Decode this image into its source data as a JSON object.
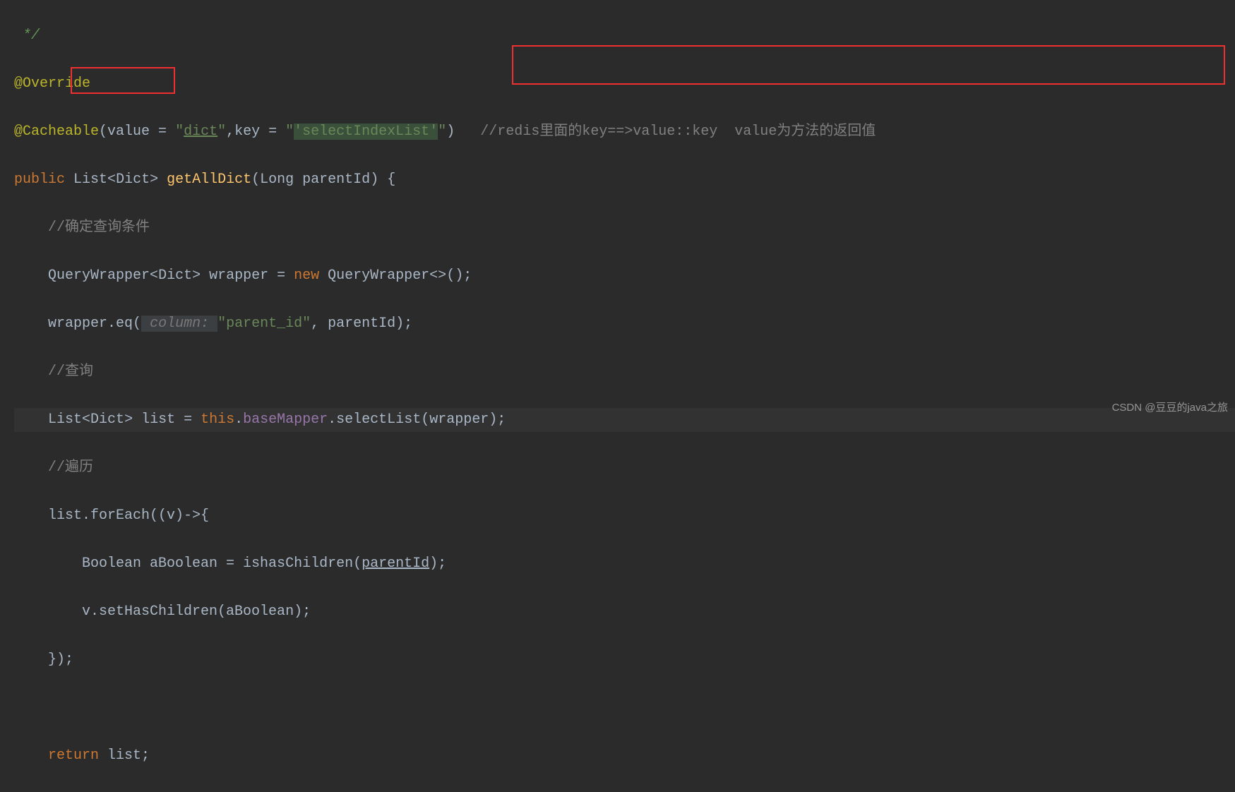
{
  "line1": {
    "star": " */"
  },
  "line2": {
    "anno": "@Override"
  },
  "line3": {
    "anno": "@Cacheable",
    "p1": "(",
    "value_key": "value = ",
    "q1": "\"",
    "dict": "dict",
    "q2": "\"",
    "comma": ",",
    "key_key": "key = ",
    "q3": "\"",
    "sel": "'selectIndexList'",
    "q4": "\"",
    "p2": ")",
    "gap": "   ",
    "comment": "//redis里面的key==>value::key  value为方法的返回值"
  },
  "line4": {
    "kw_public": "public",
    "sp1": " ",
    "list": "List",
    "lt": "<",
    "dict": "Dict",
    "gt": ">",
    "sp2": " ",
    "method": "getAllDict",
    "p1": "(",
    "long": "Long parentId",
    "p2": ") {"
  },
  "line5": {
    "indent": "    ",
    "comment": "//确定查询条件"
  },
  "line6": {
    "indent": "    ",
    "t1": "QueryWrapper",
    "lt": "<",
    "dict": "Dict",
    "gt": ">",
    "t2": " wrapper = ",
    "kw_new": "new",
    "t3": " QueryWrapper",
    "lt2": "<>",
    "p": "();"
  },
  "line7": {
    "indent": "    ",
    "t1": "wrapper.",
    "eq": "eq",
    "p1": "(",
    "hint": " column: ",
    "str": "\"parent_id\"",
    "t2": ", parentId);"
  },
  "line8": {
    "indent": "    ",
    "comment": "//查询"
  },
  "line9": {
    "indent": "    ",
    "t1": "List",
    "lt": "<",
    "dict": "Dict",
    "gt": ">",
    "t2": " list = ",
    "kw_this": "this",
    "dot": ".",
    "bm": "baseMapper",
    "dot2": ".",
    "sel": "selectList",
    "p": "(wrapper);"
  },
  "line10": {
    "indent": "    ",
    "comment": "//遍历"
  },
  "line11": {
    "indent": "    ",
    "t1": "list.forEach((v)->{"
  },
  "line12": {
    "indent": "        ",
    "t1": "Boolean aBoolean = ishasChildren(",
    "pid": "parentId",
    "t2": ");"
  },
  "line13": {
    "indent": "        ",
    "t1": "v.setHasChildren(aBoolean);"
  },
  "line14": {
    "indent": "    ",
    "t1": "});"
  },
  "line15": {
    "blank": " "
  },
  "line16": {
    "indent": "    ",
    "kw_return": "return",
    "t1": " list;"
  },
  "watermark": "CSDN @豆豆的java之旅"
}
